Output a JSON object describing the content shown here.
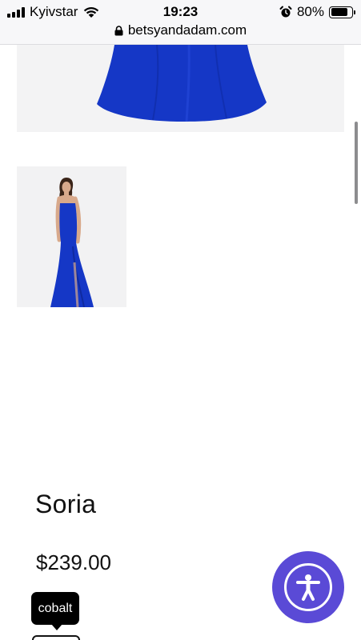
{
  "status_bar": {
    "carrier": "Kyivstar",
    "time": "19:23",
    "battery_percent": "80%",
    "battery_level": 0.8,
    "url": "betsyandadam.com"
  },
  "product": {
    "title": "Soria",
    "price": "$239.00",
    "color_label_visible": "R",
    "selected_color": "cobalt",
    "dress_color": "#1537c6"
  },
  "accessibility": {
    "button_color": "#5a4ad6",
    "icon": "accessibility-person-icon"
  }
}
